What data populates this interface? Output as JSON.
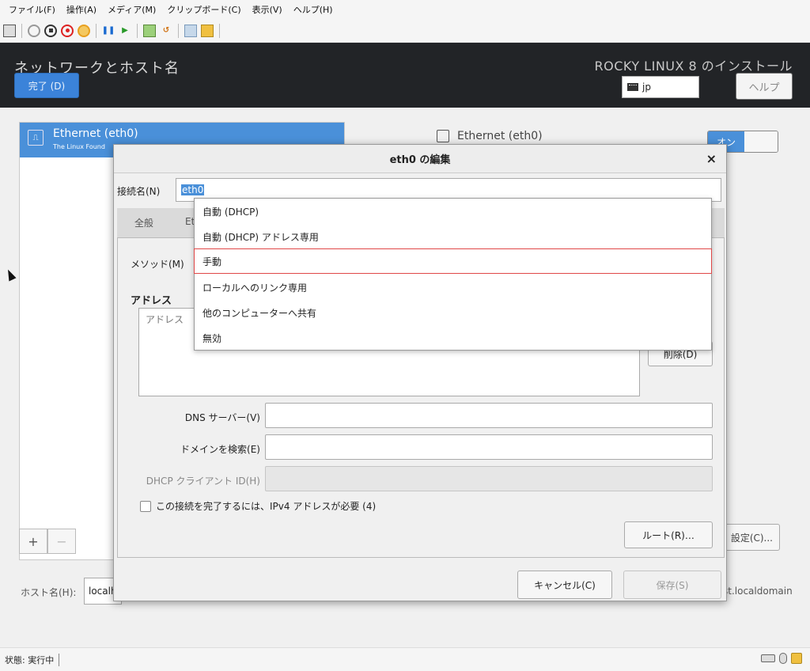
{
  "host": {
    "menu": [
      "ファイル(F)",
      "操作(A)",
      "メディア(M)",
      "クリップボード(C)",
      "表示(V)",
      "ヘルプ(H)"
    ],
    "status": "状態: 実行中"
  },
  "header": {
    "title": "ネットワークとホスト名",
    "done_label": "完了 (D)",
    "install_title": "ROCKY LINUX 8 のインストール",
    "keyboard_layout": "jp",
    "help_label": "ヘルプ"
  },
  "device_list": {
    "items": [
      {
        "name": "Ethernet (eth0)",
        "vendor": "The Linux Found"
      }
    ],
    "add_label": "+",
    "remove_label": "−"
  },
  "device_detail": {
    "name": "Ethernet (eth0)",
    "toggle_label": "オン",
    "configure_label": "設定(C)..."
  },
  "hostname": {
    "label": "ホスト名(H):",
    "value": "localh",
    "current": "st.localdomain"
  },
  "dialog": {
    "title": "eth0 の編集",
    "close": "×",
    "conn_name_label": "接続名(N)",
    "conn_name_value": "eth0",
    "tabs": [
      "全般",
      "Et"
    ],
    "method_label": "メソッド(M)",
    "address_heading": "アドレス",
    "address_column": "アドレス",
    "delete_label": "削除(D)",
    "dns_label": "DNS サーバー(V)",
    "search_label": "ドメインを検索(E)",
    "dhcp_label": "DHCP クライアント ID(H)",
    "require_ipv4_label": "この接続を完了するには、IPv4 アドレスが必要 (4)",
    "routes_label": "ルート(R)…",
    "cancel_label": "キャンセル(C)",
    "save_label": "保存(S)"
  },
  "method_dropdown": {
    "options": [
      "自動 (DHCP)",
      "自動 (DHCP) アドレス専用",
      "手動",
      "ローカルへのリンク専用",
      "他のコンピューターへ共有",
      "無効"
    ],
    "highlighted_index": 2
  }
}
